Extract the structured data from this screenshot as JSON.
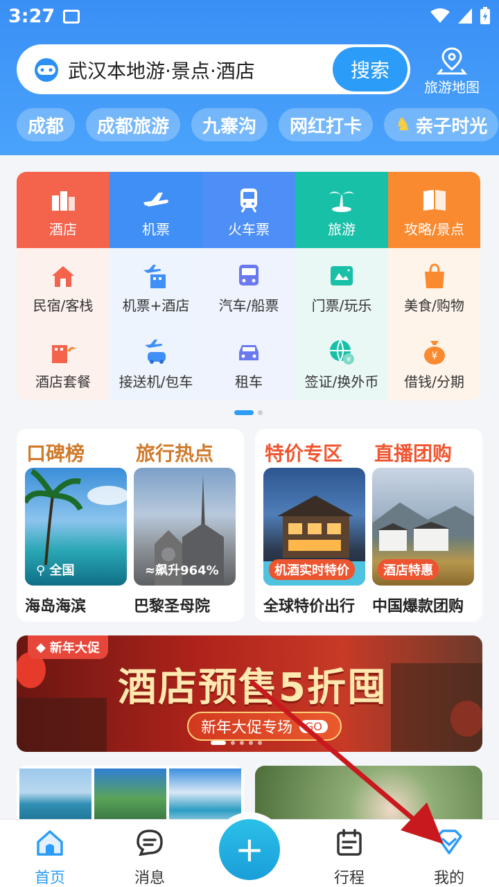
{
  "status": {
    "time": "3:27"
  },
  "search": {
    "text": "武汉本地游·景点·酒店",
    "button": "搜索",
    "map_label": "旅游地图"
  },
  "chips": [
    "成都",
    "成都旅游",
    "九寨沟",
    "网红打卡",
    "亲子时光"
  ],
  "grid_top": [
    {
      "label": "酒店",
      "icon": "hotel-icon",
      "color": "#f4634c"
    },
    {
      "label": "机票",
      "icon": "plane-icon",
      "color": "#3f8ff6"
    },
    {
      "label": "火车票",
      "icon": "train-icon",
      "color": "#4e8ff7"
    },
    {
      "label": "旅游",
      "icon": "palm-icon",
      "color": "#19c0a8"
    },
    {
      "label": "攻略/景点",
      "icon": "book-icon",
      "color": "#f98a30"
    }
  ],
  "grid_row2": [
    {
      "label": "民宿/客栈",
      "icon": "house-icon"
    },
    {
      "label": "机票+酒店",
      "icon": "plane-hotel-icon"
    },
    {
      "label": "汽车/船票",
      "icon": "bus-icon"
    },
    {
      "label": "门票/玩乐",
      "icon": "ticket-icon"
    },
    {
      "label": "美食/购物",
      "icon": "shopping-bag-icon"
    }
  ],
  "grid_row3": [
    {
      "label": "酒店套餐",
      "icon": "hotel-package-icon"
    },
    {
      "label": "接送机/包车",
      "icon": "car-transfer-icon"
    },
    {
      "label": "租车",
      "icon": "car-icon"
    },
    {
      "label": "签证/换外币",
      "icon": "globe-icon"
    },
    {
      "label": "借钱/分期",
      "icon": "money-bag-icon"
    }
  ],
  "cards": {
    "reputation": {
      "title": "口碑榜",
      "tag": "全国",
      "caption": "海岛海滨"
    },
    "hot": {
      "title": "旅行热点",
      "tag": "飙升964%",
      "caption": "巴黎圣母院"
    },
    "deal": {
      "title": "特价专区",
      "tag": "机酒实时特价",
      "caption": "全球特价出行"
    },
    "live": {
      "title": "直播团购",
      "tag": "酒店特惠",
      "caption": "中国爆款团购"
    }
  },
  "banner": {
    "badge": "新年大促",
    "title": "酒店预售5折囤",
    "subtitle": "新年大促专场"
  },
  "tabbar": [
    {
      "label": "首页",
      "icon": "home-icon"
    },
    {
      "label": "消息",
      "icon": "message-icon"
    },
    {
      "label": "行程",
      "icon": "itinerary-icon"
    },
    {
      "label": "我的",
      "icon": "profile-diamond-icon"
    }
  ]
}
